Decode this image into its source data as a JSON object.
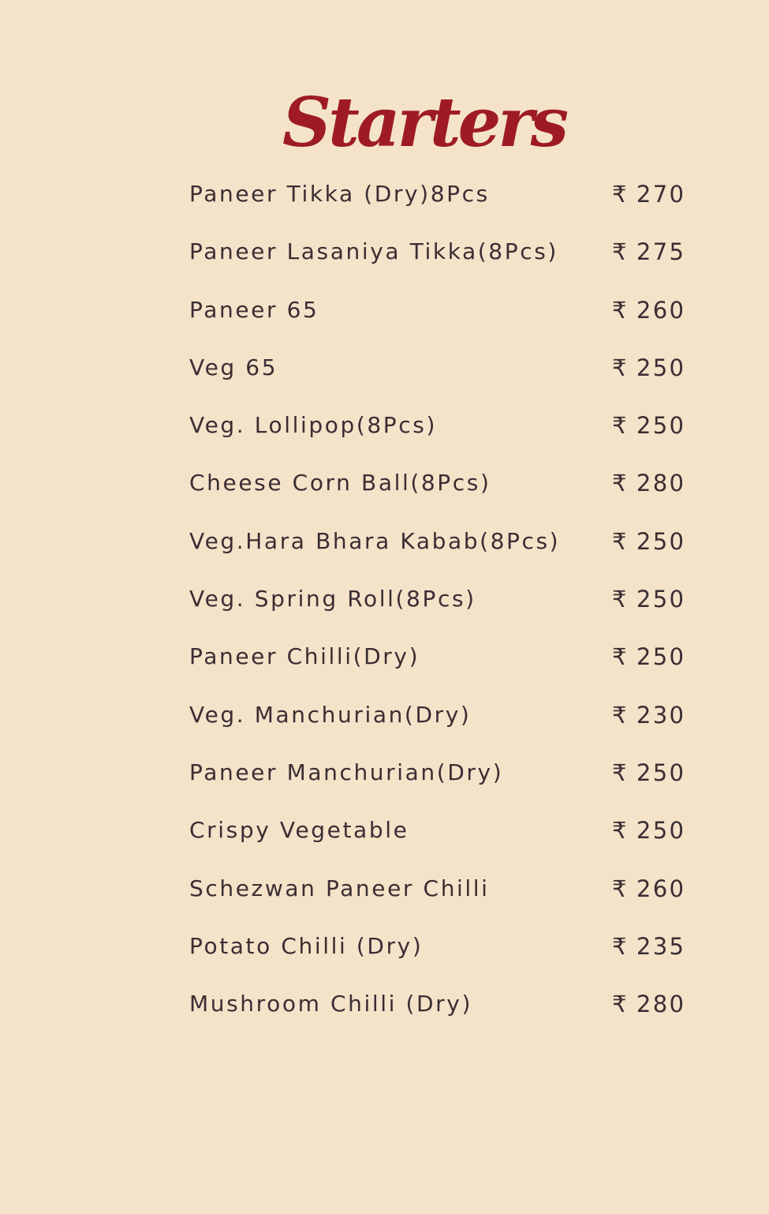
{
  "menu": {
    "title": "Starters",
    "currency_symbol": "₹",
    "items": [
      {
        "name": "Paneer Tikka (Dry)8Pcs",
        "price": "270"
      },
      {
        "name": "Paneer Lasaniya Tikka(8Pcs)",
        "price": "275"
      },
      {
        "name": "Paneer 65",
        "price": "260"
      },
      {
        "name": "Veg 65",
        "price": "250"
      },
      {
        "name": "Veg. Lollipop(8Pcs)",
        "price": "250"
      },
      {
        "name": "Cheese Corn Ball(8Pcs)",
        "price": "280"
      },
      {
        "name": "Veg.Hara Bhara Kabab(8Pcs)",
        "price": "250"
      },
      {
        "name": "Veg. Spring Roll(8Pcs)",
        "price": "250"
      },
      {
        "name": "Paneer Chilli(Dry)",
        "price": "250"
      },
      {
        "name": "Veg. Manchurian(Dry)",
        "price": "230"
      },
      {
        "name": "Paneer Manchurian(Dry)",
        "price": "250"
      },
      {
        "name": "Crispy Vegetable",
        "price": "250"
      },
      {
        "name": "Schezwan Paneer Chilli",
        "price": "260"
      },
      {
        "name": "Potato Chilli (Dry)",
        "price": "235"
      },
      {
        "name": "Mushroom Chilli (Dry)",
        "price": "280"
      }
    ]
  },
  "colors": {
    "background": "#f4e3c9",
    "title": "#9e1b24",
    "text": "#3b2d33"
  }
}
